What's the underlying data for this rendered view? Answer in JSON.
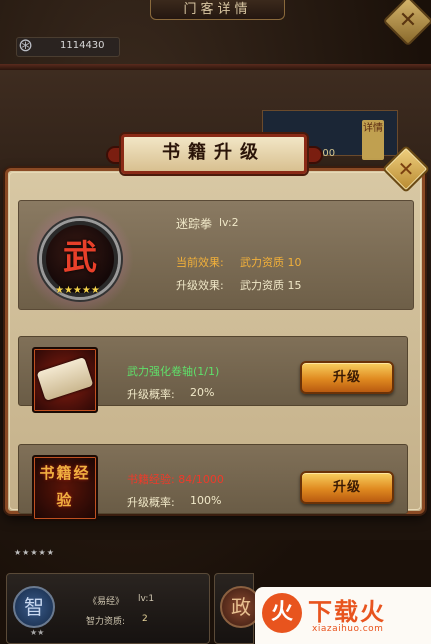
{
  "background": {
    "screen_title": "门客详情",
    "currency_value": "1114430",
    "banner_number": "100",
    "detail_tag": "详情",
    "stars_row": "★★★★★",
    "card": {
      "icon_char": "智",
      "stars": "★★",
      "book_name": "《易经》",
      "level": "lv:1",
      "stat_label": "智力资质:",
      "stat_value": "2"
    },
    "card2_icon_char": "政"
  },
  "watermark": {
    "logo_char": "火",
    "text": "下载火",
    "sub": "xiazaihuo.com"
  },
  "dialog": {
    "title": "书籍升级",
    "close_glyph": "✕",
    "skill": {
      "badge_char": "武",
      "stars": "★★★★★",
      "name": "迷踪拳",
      "level": "lv:2",
      "current_effect_label": "当前效果:",
      "current_effect_value": "武力资质 10",
      "next_effect_label": "升级效果:",
      "next_effect_value": "武力资质 15"
    },
    "items": [
      {
        "icon": "scroll-icon",
        "name": "武力强化卷轴(1/1)",
        "prob_label": "升级概率:",
        "prob_value": "20%",
        "button": "升级"
      },
      {
        "icon": "book-exp-icon",
        "icon_text": "书籍经验",
        "name": "书籍经验: 84/1000",
        "prob_label": "升级概率:",
        "prob_value": "100%",
        "button": "升级"
      }
    ]
  },
  "colors": {
    "accent_gold": "#f2b03a",
    "name_green": "#5fe06a",
    "name_red": "#ee3a2a",
    "dialog_border": "#8a4a24"
  }
}
